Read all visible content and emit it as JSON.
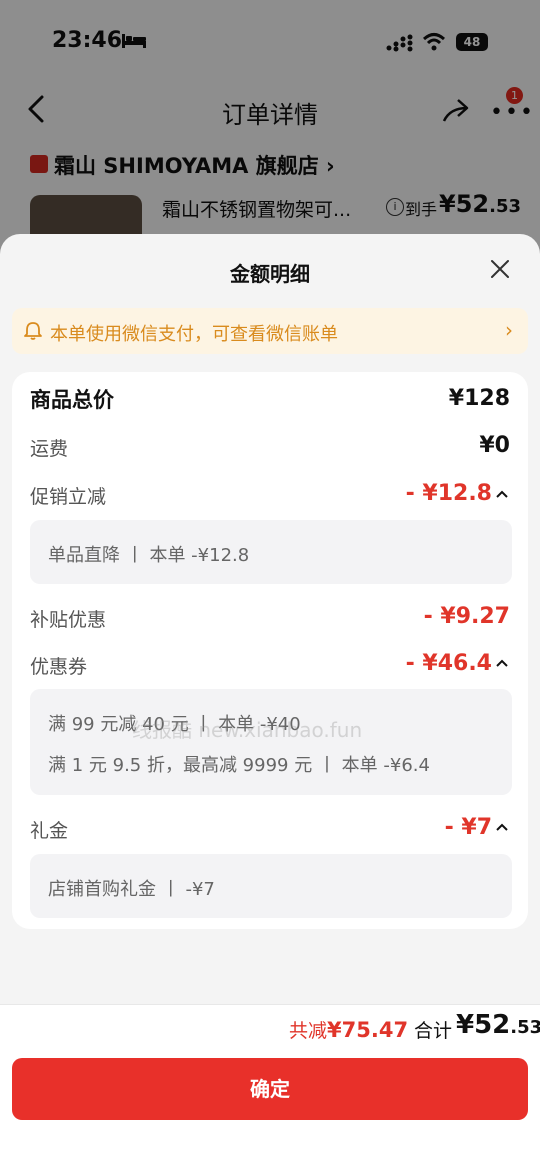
{
  "status_bar": {
    "time": "23:46",
    "battery": "48"
  },
  "nav": {
    "title": "订单详情",
    "more_badge": "1"
  },
  "store": {
    "name": "霜山 SHIMOYAMA 旗舰店 ›"
  },
  "product": {
    "title": "霜山不锈钢置物架可...",
    "price_label": "到手",
    "price_main": "¥52",
    "price_decimal": ".53"
  },
  "sheet": {
    "title": "金额明细",
    "banner": "本单使用微信支付，可查看微信账单",
    "rows": {
      "total_goods": {
        "label": "商品总价",
        "value": "¥128"
      },
      "shipping": {
        "label": "运费",
        "value": "¥0"
      },
      "promo": {
        "label": "促销立减",
        "value": "- ¥12.8",
        "detail": "单品直降 丨 本单 -¥12.8"
      },
      "subsidy": {
        "label": "补贴优惠",
        "value": "- ¥9.27"
      },
      "coupon": {
        "label": "优惠券",
        "value": "- ¥46.4",
        "detail_1": "满 99 元减 40 元 丨 本单 -¥40",
        "detail_2": "满 1 元 9.5 折，最高减 9999 元 丨 本单 -¥6.4"
      },
      "gift": {
        "label": "礼金",
        "value": "- ¥7",
        "detail": "店铺首购礼金 丨 -¥7"
      }
    },
    "watermark": "线报酷 new.xianbao.fun"
  },
  "footer": {
    "reduce_label": "共减",
    "reduce_value": "¥75.47",
    "sum_label": "合计",
    "sum_main": "¥52",
    "sum_decimal": ".53",
    "confirm": "确定"
  },
  "colors": {
    "accent": "#e8302a",
    "price_red": "#e0352a",
    "banner_text": "#d98b1e",
    "banner_bg": "#fdf4e3"
  }
}
